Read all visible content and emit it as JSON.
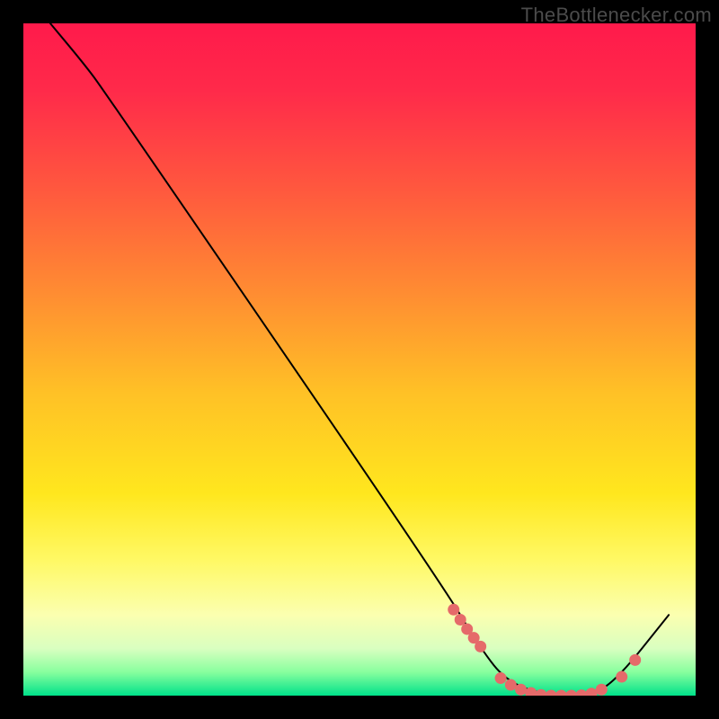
{
  "watermark": "TheBottlenecker.com",
  "chart_data": {
    "type": "line",
    "title": "",
    "xlabel": "",
    "ylabel": "",
    "xlim": [
      0,
      100
    ],
    "ylim": [
      0,
      100
    ],
    "gradient_stops": [
      {
        "offset": 0.0,
        "color": "#ff1a4b"
      },
      {
        "offset": 0.1,
        "color": "#ff2a4a"
      },
      {
        "offset": 0.25,
        "color": "#ff593e"
      },
      {
        "offset": 0.4,
        "color": "#ff8c32"
      },
      {
        "offset": 0.55,
        "color": "#ffc126"
      },
      {
        "offset": 0.7,
        "color": "#ffe71e"
      },
      {
        "offset": 0.8,
        "color": "#fff966"
      },
      {
        "offset": 0.88,
        "color": "#fbffb0"
      },
      {
        "offset": 0.93,
        "color": "#d9ffc0"
      },
      {
        "offset": 0.965,
        "color": "#88ff9e"
      },
      {
        "offset": 1.0,
        "color": "#00e18a"
      }
    ],
    "curve": [
      {
        "x": 4,
        "y": 100
      },
      {
        "x": 9,
        "y": 94
      },
      {
        "x": 12,
        "y": 90
      },
      {
        "x": 62,
        "y": 17
      },
      {
        "x": 68,
        "y": 7
      },
      {
        "x": 72,
        "y": 2
      },
      {
        "x": 78,
        "y": 0
      },
      {
        "x": 84,
        "y": 0
      },
      {
        "x": 88,
        "y": 2
      },
      {
        "x": 96,
        "y": 12
      }
    ],
    "marker_ranges": {
      "left": {
        "x_start": 64,
        "x_end": 68,
        "color": "#e56a6a"
      },
      "mid": {
        "x_start": 71,
        "x_end": 86,
        "color": "#e56a6a"
      },
      "right": {
        "x_start": 89,
        "x_end": 91,
        "color": "#e56a6a"
      }
    },
    "markers": [
      {
        "x": 64.0,
        "y": 12.8
      },
      {
        "x": 65.0,
        "y": 11.3
      },
      {
        "x": 66.0,
        "y": 9.9
      },
      {
        "x": 67.0,
        "y": 8.6
      },
      {
        "x": 68.0,
        "y": 7.3
      },
      {
        "x": 71.0,
        "y": 2.6
      },
      {
        "x": 72.5,
        "y": 1.6
      },
      {
        "x": 74.0,
        "y": 0.9
      },
      {
        "x": 75.5,
        "y": 0.4
      },
      {
        "x": 77.0,
        "y": 0.1
      },
      {
        "x": 78.5,
        "y": 0.0
      },
      {
        "x": 80.0,
        "y": 0.0
      },
      {
        "x": 81.5,
        "y": 0.0
      },
      {
        "x": 83.0,
        "y": 0.05
      },
      {
        "x": 84.5,
        "y": 0.3
      },
      {
        "x": 86.0,
        "y": 0.9
      },
      {
        "x": 89.0,
        "y": 2.8
      },
      {
        "x": 91.0,
        "y": 5.3
      }
    ],
    "marker_color": "#e56a6a",
    "marker_radius": 6.5,
    "curve_color": "#000000",
    "curve_width": 2
  }
}
